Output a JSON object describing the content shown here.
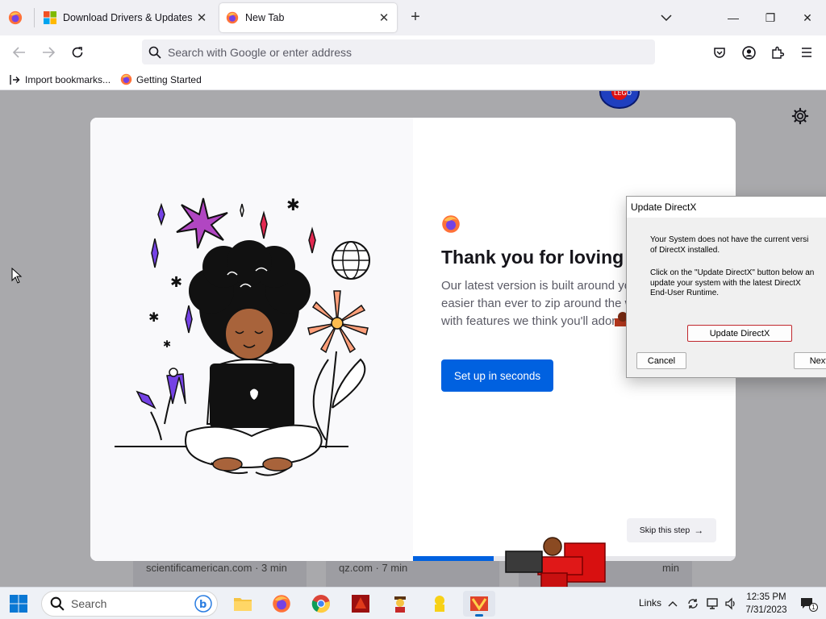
{
  "browser": {
    "tabs": [
      {
        "title": "Download Drivers & Updates for Microsoft, Windows and more",
        "active": false
      },
      {
        "title": "New Tab",
        "active": true
      }
    ],
    "window_controls": {
      "minimize": "—",
      "maximize": "❐",
      "close": "✕"
    },
    "url_placeholder": "Search with Google or enter address",
    "bookmarks": [
      {
        "label": "Import bookmarks...",
        "icon": "import-icon"
      },
      {
        "label": "Getting Started",
        "icon": "firefox-icon"
      }
    ]
  },
  "onboarding": {
    "title": "Thank you for loving F",
    "subtitle_lines": [
      "Our latest version is built around yo",
      "easier than ever to zip around the w",
      "with features we think you'll ador"
    ],
    "primary_button": "Set up in seconds",
    "skip_button": "Skip this step",
    "progress": 0.25,
    "background_cards": [
      "scientificamerican.com · 3 min",
      "qz.com · 7 min",
      "min"
    ]
  },
  "dialog": {
    "title": "Update DirectX",
    "paragraph1": [
      "Your System does not have the current versi",
      "of DirectX installed."
    ],
    "paragraph2": [
      "Click on the \"Update DirectX\" button below an",
      "update your system with the latest DirectX",
      "End-User Runtime."
    ],
    "update_button": "Update DirectX",
    "cancel_button": "Cancel",
    "next_button": "Next"
  },
  "taskbar": {
    "search_placeholder": "Search",
    "apps": [
      "file-explorer-icon",
      "firefox-icon",
      "chrome-icon",
      "game-icon",
      "lego-minifig-icon",
      "lego-figure-icon",
      "active-app-icon"
    ],
    "links_label": "Links",
    "time": "12:35 PM",
    "date": "7/31/2023",
    "notification_count": "1"
  },
  "colors": {
    "accent": "#0061e0",
    "tab_strip": "#f0f0f4",
    "page_bg": "#a9a9ac",
    "dialog_bg": "#f0f0f0"
  }
}
